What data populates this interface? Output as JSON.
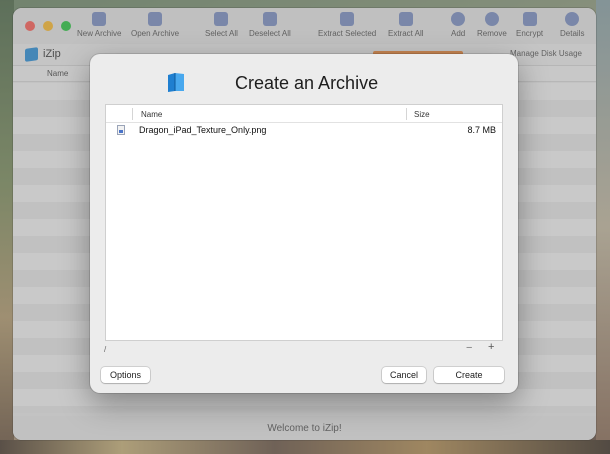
{
  "app": {
    "name": "iZip",
    "status": "Welcome to iZip!",
    "disk_usage_label": "Manage Disk Usage"
  },
  "toolbar": {
    "items": [
      {
        "label": "New Archive",
        "icon": "document-icon"
      },
      {
        "label": "Open Archive",
        "icon": "archive-box-icon"
      },
      {
        "label": "Select All",
        "icon": "checkmark-icon"
      },
      {
        "label": "Deselect All",
        "icon": "deselect-icon"
      },
      {
        "label": "Extract Selected",
        "icon": "extract-selected-icon"
      },
      {
        "label": "Extract All",
        "icon": "extract-all-icon"
      },
      {
        "label": "Add",
        "icon": "plus-circle-icon"
      },
      {
        "label": "Remove",
        "icon": "minus-circle-icon"
      },
      {
        "label": "Encrypt",
        "icon": "lock-icon"
      },
      {
        "label": "Details",
        "icon": "info-icon"
      }
    ]
  },
  "background_list": {
    "column_name": "Name"
  },
  "sheet": {
    "title": "Create an Archive",
    "table": {
      "headers": {
        "name": "Name",
        "size": "Size"
      },
      "rows": [
        {
          "name": "Dragon_iPad_Texture_Only.png",
          "size": "8.7 MB",
          "icon": "image-file-icon"
        }
      ]
    },
    "path": "/",
    "minus_label": "−",
    "plus_label": "+",
    "buttons": {
      "options": "Options",
      "cancel": "Cancel",
      "create": "Create"
    }
  },
  "colors": {
    "accent": "#2a8fd9",
    "disk_bar": "#f08a3c",
    "close": "#fe5f57",
    "minimize": "#febc2e",
    "maximize": "#28c840"
  }
}
